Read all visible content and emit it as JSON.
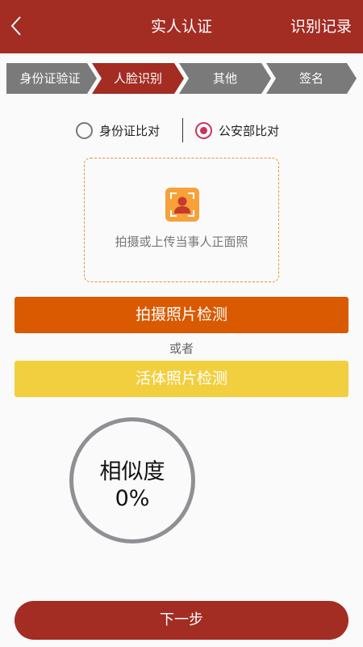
{
  "header": {
    "title": "实人认证",
    "right_action": "识别记录",
    "back_icon": "chevron-left-icon"
  },
  "steps": [
    {
      "label": "身份证验证",
      "active": false
    },
    {
      "label": "人脸识别",
      "active": true
    },
    {
      "label": "其他",
      "active": false
    },
    {
      "label": "签名",
      "active": false
    }
  ],
  "compare": {
    "options": [
      {
        "label": "身份证比对",
        "selected": false
      },
      {
        "label": "公安部比对",
        "selected": true
      }
    ]
  },
  "upload": {
    "icon": "face-scan-icon",
    "text": "拍摄或上传当事人正面照"
  },
  "buttons": {
    "capture": "拍摄照片检测",
    "or": "或者",
    "live": "活体照片检测",
    "next": "下一步"
  },
  "similarity": {
    "label": "相似度",
    "value": "0%"
  },
  "colors": {
    "brand": "#a32c23",
    "step_inactive": "#7a7a7a",
    "accent_orange": "#d95a00",
    "accent_yellow": "#f2cf3e",
    "radio_selected": "#c8345e",
    "dashed_border": "#e6923c"
  }
}
